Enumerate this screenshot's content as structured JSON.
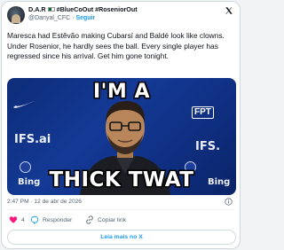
{
  "author": {
    "display_name": "D.A.R",
    "flag_icon": "flag-icon",
    "hashtags": "#BlueCoOut #RoseniorOut",
    "handle": "@Danyal_CFC",
    "separator": "·",
    "follow_label": "Seguir"
  },
  "brand_icon": "x-logo-icon",
  "tweet": {
    "text": "Maresca had Estêvão making Cubarsí and Baldé look like clowns. Under Rosenior, he hardly sees the ball. Every single player has regressed since his arrival. Get him gone tonight."
  },
  "media": {
    "top_caption": "I'M A",
    "bottom_caption": "THICK TWAT",
    "sponsors": {
      "ifs_left": "IFS.ai",
      "ifs_right": "IFS.",
      "bing_left": "Bing",
      "bing_right": "Bing",
      "fpt": "FPT"
    },
    "background_color": "#143a96"
  },
  "meta": {
    "timestamp": "2:47 PM · 12 de abr de 2026"
  },
  "actions": {
    "like_count": "4",
    "reply_label": "Responder",
    "copy_link_label": "Copiar link"
  },
  "read_more_label": "Leia mais no X",
  "colors": {
    "accent": "#1d9bf0",
    "like": "#f91880",
    "text": "#0f1419",
    "muted": "#536471"
  }
}
